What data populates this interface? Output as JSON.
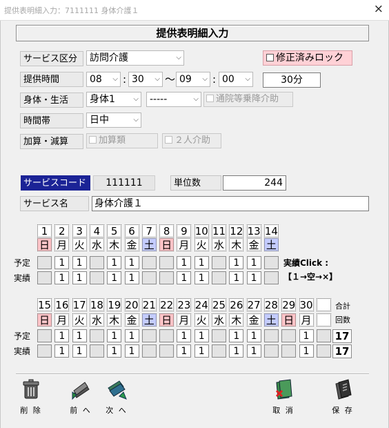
{
  "window": {
    "title": "提供表明細入力：7111111 身体介護１",
    "close_label": "×"
  },
  "header": {
    "title": "提供表明細入力"
  },
  "form": {
    "service_type": {
      "label": "サービス区分",
      "value": "訪問介護"
    },
    "lock": {
      "label": "修正済みロック"
    },
    "time": {
      "label": "提供時間",
      "start_hour": "08",
      "start_min": "30",
      "tilde": "～",
      "end_hour": "09",
      "end_min": "00",
      "colon": ":",
      "duration": "30分"
    },
    "body_life": {
      "label": "身体・生活",
      "value": "身体1",
      "value2": "-----",
      "check_label": "通院等乗降介助"
    },
    "time_zone": {
      "label": "時間帯",
      "value": "日中"
    },
    "addition": {
      "label": "加算・減算",
      "check1": "加算類",
      "check2": "２人介助"
    },
    "service_code": {
      "label": "サービスコード",
      "value": "111111"
    },
    "units": {
      "label": "単位数",
      "value": "244"
    },
    "service_name": {
      "label": "サービス名",
      "value": "身体介護１"
    }
  },
  "calendar": {
    "row_labels": {
      "plan": "予定",
      "actual": "実績"
    },
    "note": {
      "line1": "実績Click :",
      "line2": "【１→空→×】"
    },
    "total": {
      "label1": "合計",
      "label2": "回数",
      "plan": "17",
      "actual": "17"
    },
    "week1": {
      "days": [
        "1",
        "2",
        "3",
        "4",
        "5",
        "6",
        "7",
        "8",
        "9",
        "10",
        "11",
        "12",
        "13",
        "14"
      ],
      "weekdays": [
        "日",
        "月",
        "火",
        "水",
        "木",
        "金",
        "土",
        "日",
        "月",
        "火",
        "水",
        "木",
        "金",
        "土"
      ],
      "plan": [
        "",
        "1",
        "1",
        "",
        "1",
        "1",
        "",
        "",
        "1",
        "1",
        "",
        "1",
        "1",
        ""
      ],
      "actual": [
        "",
        "1",
        "1",
        "",
        "1",
        "1",
        "",
        "",
        "1",
        "1",
        "",
        "1",
        "1",
        ""
      ]
    },
    "week2": {
      "days": [
        "15",
        "16",
        "17",
        "18",
        "19",
        "20",
        "21",
        "22",
        "23",
        "24",
        "25",
        "26",
        "27",
        "28",
        "29",
        "30",
        ""
      ],
      "weekdays": [
        "日",
        "月",
        "火",
        "水",
        "木",
        "金",
        "土",
        "日",
        "月",
        "火",
        "水",
        "木",
        "金",
        "土",
        "日",
        "月",
        ""
      ],
      "plan": [
        "",
        "1",
        "1",
        "",
        "1",
        "1",
        "",
        "",
        "1",
        "1",
        "",
        "1",
        "1",
        "",
        "",
        "1",
        ""
      ],
      "actual": [
        "",
        "1",
        "1",
        "",
        "1",
        "1",
        "",
        "",
        "1",
        "1",
        "",
        "1",
        "1",
        "",
        "",
        "1",
        ""
      ]
    }
  },
  "toolbar": {
    "delete": "削 除",
    "prev": "前 へ",
    "next": "次 へ",
    "cancel": "取 消",
    "save": "保 存"
  },
  "colors": {
    "sunday": "#ffc4c8",
    "saturday": "#c4ccff",
    "code_label_bg": "#1b2396",
    "lock_bg": "#ffd1d6"
  }
}
